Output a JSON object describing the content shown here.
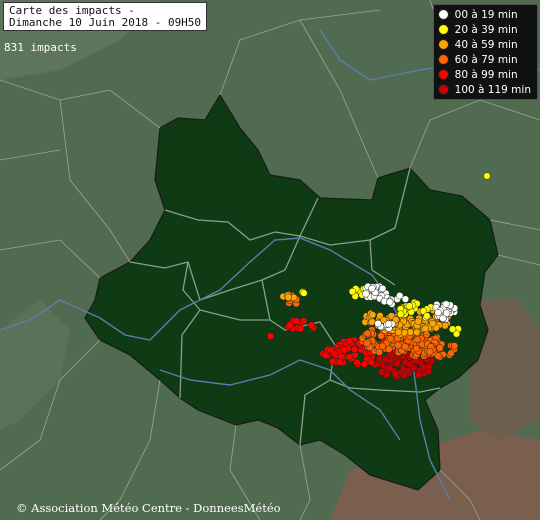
{
  "header": {
    "title_line1": "Carte des impacts -",
    "title_line2": "Dimanche 10 Juin 2018 - 09H50"
  },
  "impact_count": "831 impacts",
  "legend": [
    {
      "label": "00 à 19 min",
      "color": "#ffffff"
    },
    {
      "label": "20 à 39 min",
      "color": "#ffff00"
    },
    {
      "label": "40 à 59 min",
      "color": "#ffa500"
    },
    {
      "label": "60 à 79 min",
      "color": "#ff6600"
    },
    {
      "label": "80 à 99 min",
      "color": "#ff0000"
    },
    {
      "label": "100 à 119 min",
      "color": "#cc0000"
    }
  ],
  "footer": {
    "credit": "© Association Météo Centre - DonneesMétéo"
  },
  "colors": {
    "region_fill": "#0e3a14",
    "outside_land": "#4f6a4f",
    "borders": "#9aa89a",
    "rivers": "#5a7fa8"
  }
}
